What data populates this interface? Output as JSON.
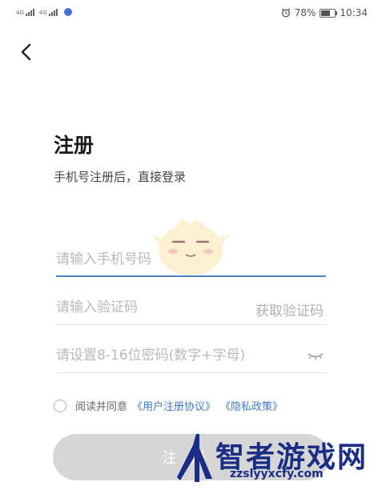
{
  "status_bar": {
    "left_icons": [
      "signal-4g-icon",
      "signal-4g-icon",
      "notification-dot-icon"
    ],
    "signal_label": "4G",
    "battery_percent": "78%",
    "time": "10:34",
    "alarm_icon": "alarm-icon",
    "battery_level": 0.78
  },
  "nav": {
    "back_icon": "chevron-left-icon"
  },
  "page": {
    "title": "注册",
    "subtitle": "手机号注册后，直接登录"
  },
  "form": {
    "phone": {
      "placeholder": "请输入手机号码",
      "value": ""
    },
    "code": {
      "placeholder": "请输入验证码",
      "value": "",
      "get_code_label": "获取验证码"
    },
    "password": {
      "placeholder": "请设置8-16位密码(数字+字母)",
      "value": "",
      "eye_icon": "eye-closed-icon"
    }
  },
  "agreement": {
    "checked": false,
    "prefix": "阅读并同意",
    "user_agreement": "《用户注册协议》",
    "privacy_policy": "《隐私政策》"
  },
  "submit": {
    "label": "注册"
  },
  "watermark": {
    "name": "智者游戏网",
    "url": "zzslyyxcfy.com"
  },
  "colors": {
    "accent": "#4a84c8",
    "link": "#3f7ac9",
    "button_disabled": "#d6d6d6",
    "placeholder": "#b9b9b9",
    "watermark": "#1a2d84"
  }
}
